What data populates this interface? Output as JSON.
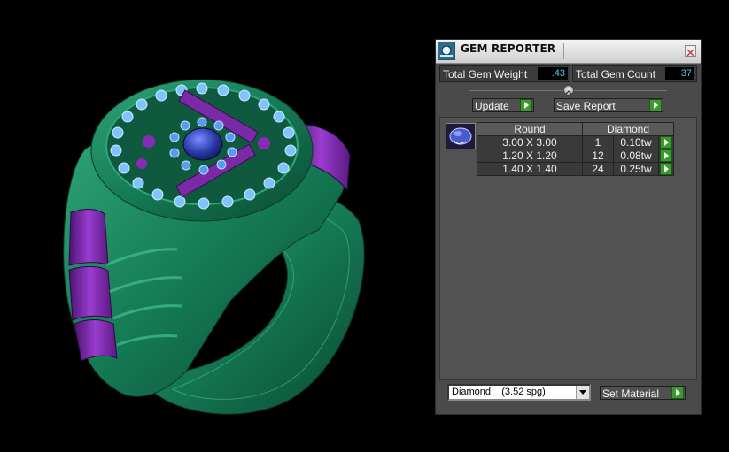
{
  "viewport": {
    "description": "ring-3d-render"
  },
  "panel": {
    "title": "GEM REPORTER",
    "total_weight_label": "Total Gem Weight",
    "total_weight_value": ".43",
    "total_count_label": "Total Gem Count",
    "total_count_value": "37",
    "update_label": "Update",
    "save_report_label": "Save Report"
  },
  "table": {
    "headers": [
      "Round",
      "Diamond"
    ],
    "rows": [
      {
        "size": "3.00 X 3.00",
        "count": "1",
        "weight": "0.10tw"
      },
      {
        "size": "1.20 X 1.20",
        "count": "12",
        "weight": "0.08tw"
      },
      {
        "size": "1.40 X 1.40",
        "count": "24",
        "weight": "0.25tw"
      }
    ]
  },
  "material": {
    "selected": "Diamond    (3.52 spg)",
    "set_label": "Set Material"
  },
  "colors": {
    "accent_green": "#3a9a2e",
    "value_text": "#3fd0ea",
    "metal_green": "#1b7a56",
    "metal_purple": "#7a2aa6"
  }
}
